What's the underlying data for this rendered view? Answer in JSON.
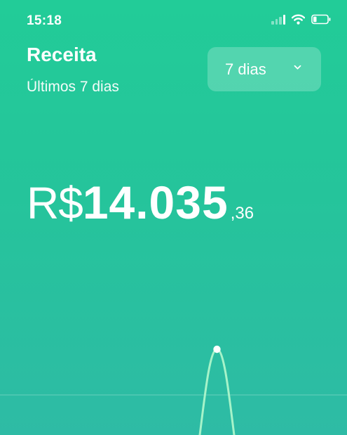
{
  "status_bar": {
    "time": "15:18",
    "icons": [
      "signal-icon",
      "wifi-icon",
      "battery-icon"
    ]
  },
  "header": {
    "title": "Receita",
    "subtitle": "Últimos 7 dias"
  },
  "period_select": {
    "selected": "7 dias"
  },
  "revenue": {
    "currency": "R$",
    "integer": "14.035",
    "decimal": ",36"
  },
  "colors": {
    "background_top": "#22cc98",
    "background_bottom": "#2ebba5",
    "line": "#a6f3c9",
    "text": "#ffffff"
  },
  "chart_data": {
    "type": "line",
    "grid": true,
    "highlighted_point": "peak",
    "series": [
      {
        "values": [
          0,
          1,
          0
        ]
      }
    ]
  }
}
